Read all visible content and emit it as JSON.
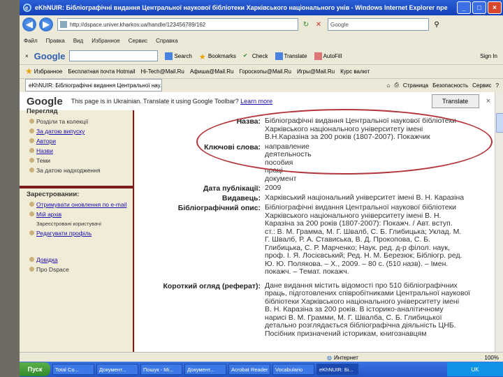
{
  "window": {
    "title": "eKhNUIR: Бібліографічні видання Центральної наукової бібліотеки Харківського національного унів - Windows Internet Explorer npe",
    "min": "_",
    "max": "□",
    "close": "×"
  },
  "address": {
    "url": "http://dspace.univer.kharkov.ua/handle/123456789/162",
    "search": "Google"
  },
  "menu": [
    "Файл",
    "Правка",
    "Вид",
    "Избранное",
    "Сервис",
    "Справка"
  ],
  "google_toolbar": {
    "logo": "Google",
    "items": [
      "Search",
      "Bookmarks",
      "Check",
      "Translate",
      "AutoFill",
      "Sign In"
    ]
  },
  "favorites": {
    "label": "Избранное",
    "items": [
      "Бесплатная почта Hotmail",
      "Hi-Tech@Mail.Ru",
      "Афиша@Mail.Ru",
      "Гороскопы@Mail.Ru",
      "Игры@Mail.Ru",
      "Курс валют"
    ]
  },
  "tab": {
    "label": "eKhNUIR: Бібліографічні видання Центральної нау...",
    "tools": [
      "Страница",
      "Безопасность",
      "Сервис"
    ]
  },
  "translate_bar": {
    "logo": "Google",
    "message": "This page is in Ukrainian. Translate it using Google Toolbar?",
    "learn_more": "Learn more",
    "button": "Translate"
  },
  "sidebar": {
    "top_header": "Перегляд",
    "browse": [
      "Розділи та колекції",
      "За датою випуску",
      "Автори",
      "Назви",
      "Теми",
      "За датою надходження"
    ],
    "registered_header": "Зарестровании:",
    "registered": [
      "Отримувати оновлення по e-mail",
      "Мій архів",
      "Зареєстровані користувачі",
      "Редагувати профіль"
    ],
    "help": [
      "Довідка",
      "Про Dspace"
    ]
  },
  "record": {
    "fields": [
      {
        "label": "Назва:",
        "lines": [
          "Бібліографічні видання Центральної наукової бібліотеки",
          "Харківського національного університету імені",
          "В.Н.Каразіна за 200 років (1807-2007). Покажчик"
        ]
      },
      {
        "label": "Ключові слова:",
        "lines": [
          "направление",
          "деятельность",
          "пособия",
          "працi",
          "документ"
        ]
      },
      {
        "label": "Дата публікації:",
        "lines": [
          "2009"
        ]
      },
      {
        "label": "Видавець:",
        "lines": [
          "Харківський національний університет імені В. Н. Каразіна"
        ]
      },
      {
        "label": "Бібліографічний опис:",
        "lines": [
          "Бібліографічні видання Центральної наукової бібліотеки",
          "Харківського національного університету імені В. Н.",
          "Каразіна за 200 років (1807-2007): Покажч. / Авт. вступ.",
          "ст.: В. М. Грамма, М. Г. Швалб, С. Б. Глибицька; Уклад. М.",
          "Г. Швалб, Р. А. Стависька, В. Д. Прокопова, С. Б.",
          "Глибицька, С. Р. Марченко; Наук. ред. д-р філол. наук,",
          "проф. І. Я. Лосієвський; Ред. Н. М. Березюк; Бібліогр. ред.",
          "Ю. Ю. Полякова. – Х., 2009. – 80 с. (510 назв). – Імен.",
          "покажч. – Темат. покажч."
        ]
      },
      {
        "label": "Короткий огляд (реферат):",
        "lines": [
          "Дане видання містить відомості про 510 бібліографічних",
          "праць, підготовлених співробітниками Центральної наукової",
          "бібліотеки Харківського національного університету імені",
          "В. Н. Каразіна за 200 років. В історико-аналітичному",
          "нарисі В. М. Грамми, М. Г. Швалба, С. Б. Глибицької",
          "детально розглядається бібліографічна діяльність ЦНБ.",
          "Посібник призначений історикам, книгознавцям"
        ]
      }
    ]
  },
  "status": {
    "zone": "Интернет",
    "zoom": "100%"
  },
  "taskbar": {
    "start": "Пуск",
    "tasks": [
      "Total Co...",
      "Документ...",
      "Пошук - Mi...",
      "Документ...",
      "Acrobat Reader",
      "Vocabulario",
      "eKhNUIR: Бі..."
    ],
    "tray": "UK"
  }
}
